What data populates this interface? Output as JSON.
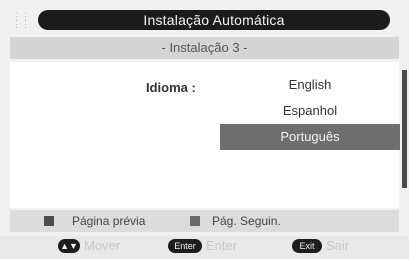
{
  "header": {
    "title": "Instalação Automática",
    "subtitle": "- Instalação 3 -"
  },
  "language": {
    "label": "Idioma :",
    "options": [
      "English",
      "Espanhol",
      "Português"
    ],
    "selected": "Português"
  },
  "footer": {
    "prev_page": "Página prévia",
    "next_page": "Pág. Seguin.",
    "move_key": "▲▼",
    "move_label": "Mover",
    "enter_key": "Enter",
    "enter_label": "Enter",
    "exit_key": "Exit",
    "exit_label": "Sair"
  }
}
